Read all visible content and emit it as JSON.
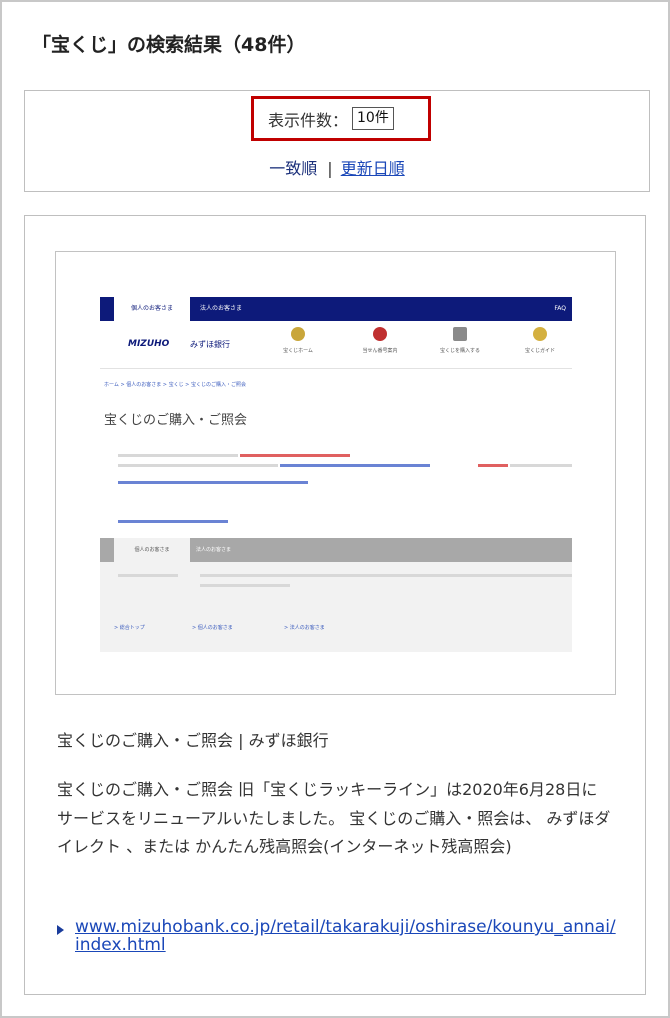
{
  "page": {
    "heading": "「宝くじ」の検索結果（48件）"
  },
  "controls": {
    "count_label": "表示件数：",
    "count_value": "10件",
    "sort_current": "一致順",
    "sort_separator": "|",
    "sort_link": "更新日順"
  },
  "result": {
    "title": "宝くじのご購入・ご照会 | みずほ銀行",
    "description": "宝くじのご購入・ご照会 旧「宝くじラッキーライン」は2020年6月28日に サービスをリニューアルいたしました。 宝くじのご購入・照会は、 みずほダイレクト 、または かんたん残高照会(インターネット残高照会)",
    "url": "www.mizuhobank.co.jp/retail/takarakuji/oshirase/kounyu_annai/index.html",
    "thumbnail": {
      "tab_active": "個人のお客さま",
      "tab_second": "法人のお客さま",
      "tab_right": "FAQ",
      "logo": "MIZUHO",
      "bank_name": "みずほ銀行",
      "nav": [
        {
          "label": "宝くじホーム",
          "icon": "lightbulb-icon",
          "color": "#c9a63a"
        },
        {
          "label": "当せん番号案内",
          "icon": "target-icon",
          "color": "#c03030"
        },
        {
          "label": "宝くじを購入する",
          "icon": "cart-icon",
          "color": "#8a8a8a"
        },
        {
          "label": "宝くじガイド",
          "icon": "bulb-icon",
          "color": "#d4b040"
        }
      ],
      "breadcrumb": "ホーム > 個人のお客さま > 宝くじ > 宝くじのご購入・ご照会",
      "title": "宝くじのご購入・ご照会",
      "grey_tab": "個人のお客さま",
      "grey_tab2": "法人のお客さま",
      "footer_links": [
        "> 総合トップ",
        "> 個人のお客さま",
        "> 法人のお客さま"
      ]
    }
  },
  "colors": {
    "highlight_border": "#c00000",
    "link": "#1a47b8",
    "navy": "#0d1a7a"
  }
}
